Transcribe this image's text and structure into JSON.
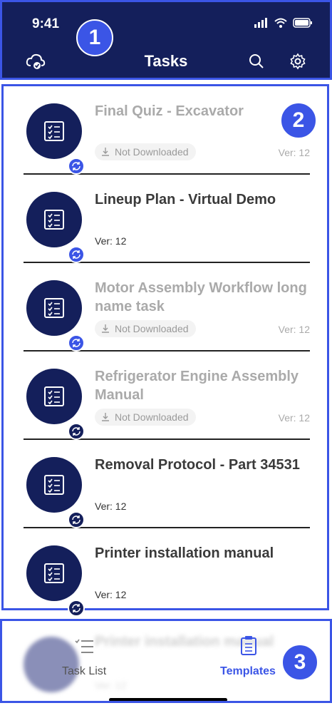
{
  "status_bar": {
    "time": "9:41"
  },
  "header": {
    "title": "Tasks"
  },
  "badges": [
    "1",
    "2",
    "3"
  ],
  "tasks": [
    {
      "name": "Final Quiz - Excavator",
      "status": "Not Downloaded",
      "version": "Ver: 12",
      "downloaded": false,
      "sync": "blue"
    },
    {
      "name": "Lineup Plan - Virtual Demo",
      "status": "",
      "version": "Ver: 12",
      "downloaded": true,
      "sync": "blue"
    },
    {
      "name": "Motor Assembly Workflow long name task",
      "status": "Not Downloaded",
      "version": "Ver: 12",
      "downloaded": false,
      "sync": "blue"
    },
    {
      "name": "Refrigerator Engine Assembly Manual",
      "status": "Not Downloaded",
      "version": "Ver: 12",
      "downloaded": false,
      "sync": "dark"
    },
    {
      "name": "Removal Protocol - Part 34531",
      "status": "",
      "version": "Ver: 12",
      "downloaded": true,
      "sync": "dark"
    },
    {
      "name": "Printer installation manual",
      "status": "",
      "version": "Ver: 12",
      "downloaded": true,
      "sync": "dark"
    }
  ],
  "bottom_nav": {
    "task_list_label": "Task List",
    "templates_label": "Templates",
    "ghost_item_name": "Printer installation manual",
    "ghost_item_version": "Ver: 12"
  },
  "colors": {
    "header_bg": "#141f5b",
    "accent": "#3b55e6",
    "dim_text": "#aaaaaa",
    "dark_text": "#3a3a3a"
  }
}
